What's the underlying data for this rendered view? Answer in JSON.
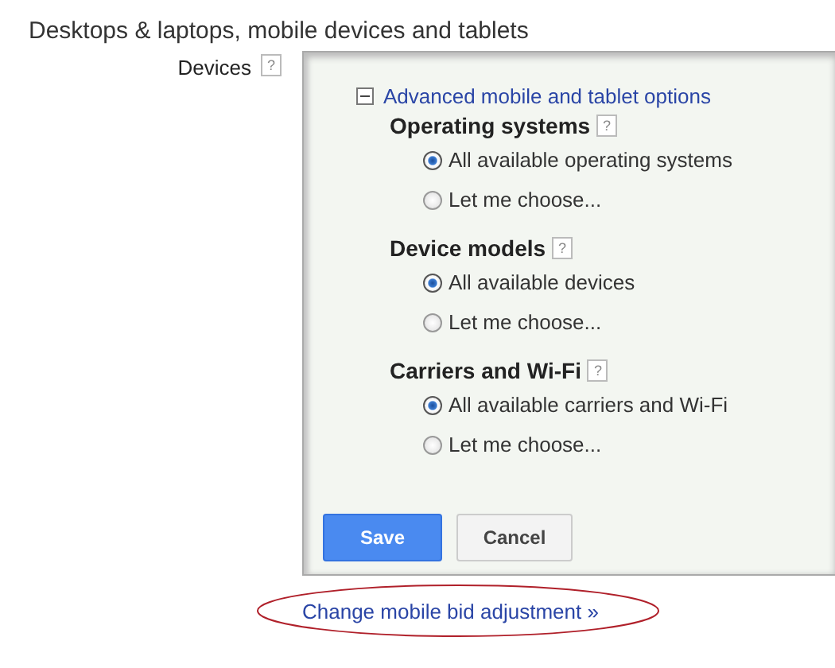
{
  "heading": "Desktops & laptops, mobile devices and tablets",
  "devices": {
    "label": "Devices",
    "help": "?"
  },
  "panel": {
    "toggle_label": "Advanced mobile and tablet options",
    "expanded": true,
    "sections": [
      {
        "title": "Operating systems",
        "help": "?",
        "options": [
          {
            "label": "All available operating systems",
            "selected": true
          },
          {
            "label": "Let me choose...",
            "selected": false
          }
        ]
      },
      {
        "title": "Device models",
        "help": "?",
        "options": [
          {
            "label": "All available devices",
            "selected": true
          },
          {
            "label": "Let me choose...",
            "selected": false
          }
        ]
      },
      {
        "title": "Carriers and Wi-Fi",
        "help": "?",
        "options": [
          {
            "label": "All available carriers and Wi-Fi",
            "selected": true
          },
          {
            "label": "Let me choose...",
            "selected": false
          }
        ]
      }
    ],
    "buttons": [
      {
        "label": "Save",
        "kind": "primary"
      },
      {
        "label": "Cancel",
        "kind": "secondary"
      }
    ]
  },
  "link": "Change mobile bid adjustment »"
}
